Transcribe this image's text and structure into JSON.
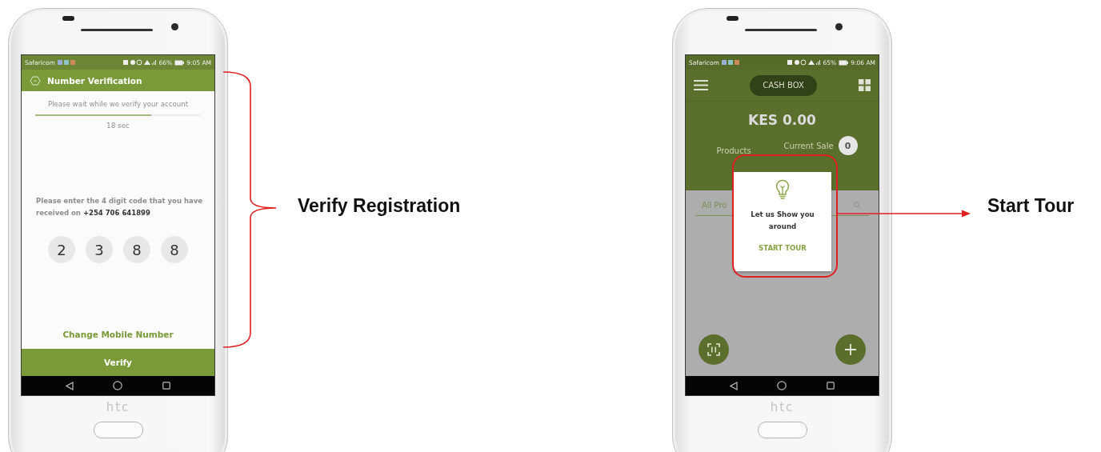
{
  "phones": [
    {
      "kind": "verification",
      "status_bar": {
        "carrier": "Safaricom",
        "battery": "66%",
        "time": "9:05 AM"
      },
      "header": {
        "title": "Number Verification"
      },
      "wait_message": "Please wait while we verify your account",
      "progress": {
        "level": 0.7
      },
      "countdown": "18 sec",
      "instruction": "Please enter the 4 digit code that you have received on **+254 706 641899**",
      "code_digits": [
        "2",
        "3",
        "8",
        "8"
      ],
      "change_link": "Change Mobile Number",
      "verify_button": "Verify",
      "brand": "htc"
    },
    {
      "kind": "cashbox",
      "status_bar": {
        "carrier": "Safaricom",
        "battery": "65%",
        "time": "9:06 AM"
      },
      "account_button": "CASH BOX",
      "balance": "KES 0.00",
      "tabs": [
        {
          "label": "Products"
        },
        {
          "label": "Current Sale",
          "badge": "0"
        }
      ],
      "search": {
        "value": "All Pro"
      },
      "popup": {
        "message": "Let us Show you around",
        "action": "START TOUR"
      },
      "brand": "htc"
    }
  ],
  "annotations": [
    {
      "kind": "bracket",
      "label": "Verify Registration"
    },
    {
      "kind": "arrow",
      "label": "Start Tour"
    }
  ]
}
